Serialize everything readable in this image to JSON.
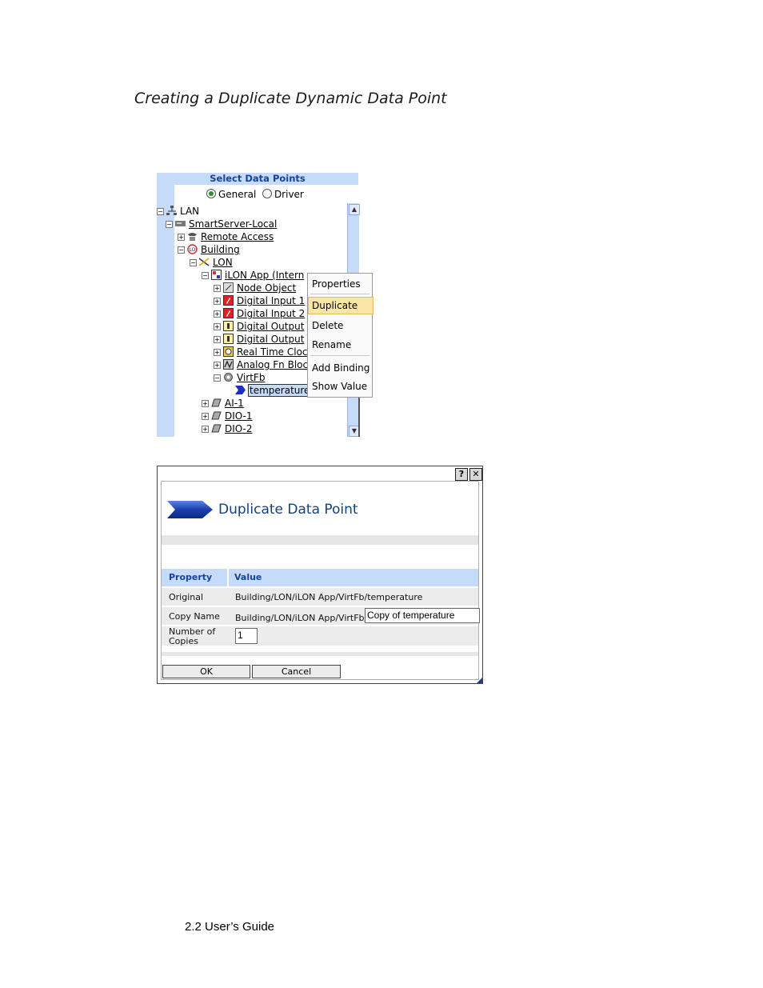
{
  "heading": "Creating a Duplicate Dynamic Data Point",
  "footer": "2.2 User’s Guide",
  "tree_panel": {
    "header": "Select Data Points",
    "radio_general": "General",
    "radio_driver": "Driver",
    "selected_radio": "General",
    "nodes": [
      {
        "label": "LAN",
        "expander": "−",
        "icon": "network-icon"
      },
      {
        "label": "SmartServer-Local",
        "expander": "−",
        "icon": "server-icon"
      },
      {
        "label": "Remote Access",
        "expander": "+",
        "icon": "phone-icon"
      },
      {
        "label": "Building",
        "expander": "−",
        "icon": "building-icon"
      },
      {
        "label": "LON",
        "expander": "−",
        "icon": "lon-network-icon"
      },
      {
        "label": "iLON App (Intern",
        "expander": "−",
        "icon": "device-icon"
      },
      {
        "label": "Node Object",
        "expander": "+",
        "icon": "node-object-icon"
      },
      {
        "label": "Digital Input 1",
        "expander": "+",
        "icon": "digital-input-icon"
      },
      {
        "label": "Digital Input 2",
        "expander": "+",
        "icon": "digital-input-icon"
      },
      {
        "label": "Digital Output",
        "expander": "+",
        "icon": "digital-output-icon"
      },
      {
        "label": "Digital Output",
        "expander": "+",
        "icon": "digital-output-icon"
      },
      {
        "label": "Real Time Cloc",
        "expander": "+",
        "icon": "clock-icon"
      },
      {
        "label": "Analog Fn Bloc",
        "expander": "+",
        "icon": "analog-fn-icon"
      },
      {
        "label": "VirtFb",
        "expander": "−",
        "icon": "gear-icon"
      },
      {
        "label": "temperature",
        "expander": "",
        "icon": "datapoint-arrow-icon"
      },
      {
        "label": "AI-1",
        "expander": "+",
        "icon": "device-module-icon"
      },
      {
        "label": "DIO-1",
        "expander": "+",
        "icon": "device-module-icon"
      },
      {
        "label": "DIO-2",
        "expander": "+",
        "icon": "device-module-icon"
      }
    ]
  },
  "context_menu": {
    "items": [
      "Properties",
      "Duplicate",
      "Delete",
      "Rename",
      "Add Binding",
      "Show Value"
    ],
    "highlighted": "Duplicate"
  },
  "dialog": {
    "help_button": "?",
    "close_button": "✕",
    "title": "Duplicate Data Point",
    "columns": [
      "Property",
      "Value"
    ],
    "rows": {
      "original": {
        "label": "Original",
        "value": "Building/LON/iLON App/VirtFb/temperature"
      },
      "copy_name": {
        "label": "Copy Name",
        "prefix": "Building/LON/iLON App/VirtFb/",
        "value": "Copy of temperature"
      },
      "copies": {
        "label_line1": "Number of",
        "label_line2": "Copies",
        "value": "1"
      }
    },
    "ok_label": "OK",
    "cancel_label": "Cancel"
  },
  "colors": {
    "panel_blue": "#c6dafa",
    "title_blue": "#14417d",
    "menu_highlight": "#fbe6a8"
  }
}
